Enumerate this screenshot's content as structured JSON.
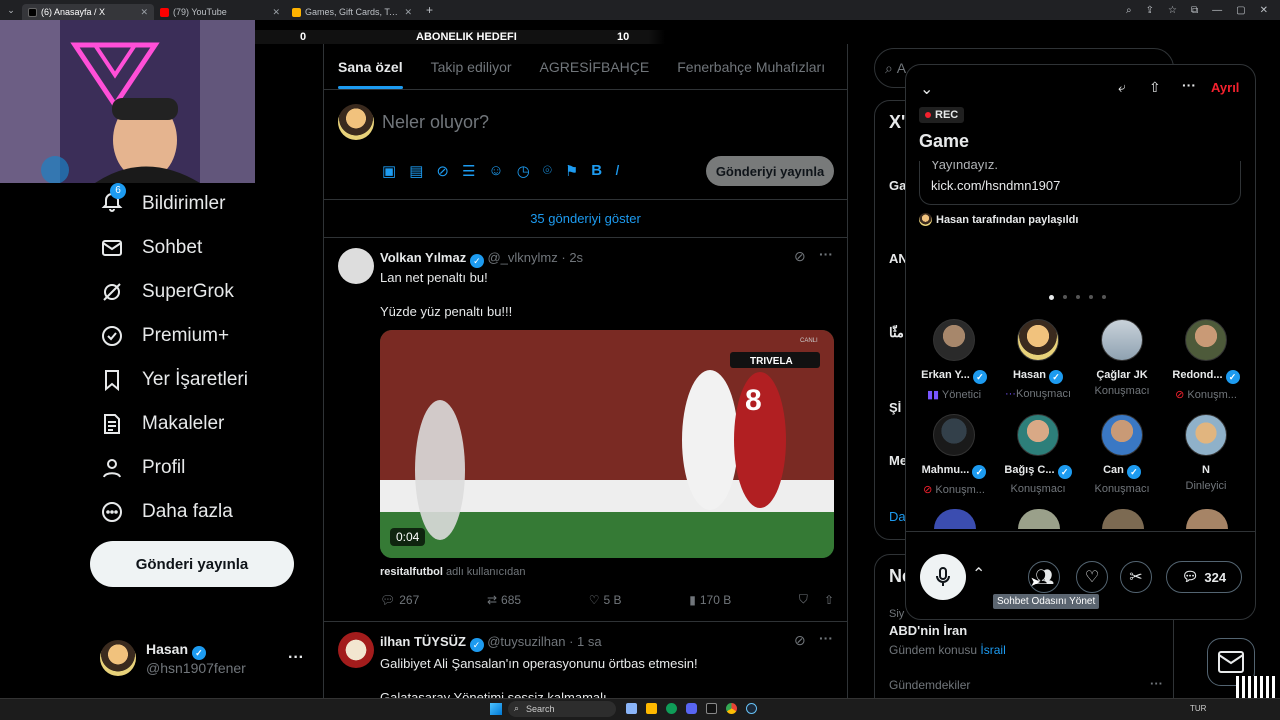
{
  "browser": {
    "tabs": [
      {
        "label": "(6) Anasayfa / X",
        "active": true,
        "color": "#ffffff"
      },
      {
        "label": "(79) YouTube",
        "active": false,
        "color": "#ff0000"
      },
      {
        "label": "Games, Gift Cards, Top-Ups & ...",
        "active": false,
        "color": "#ffb300"
      }
    ],
    "new_tab": "+"
  },
  "overlay": {
    "left_value": "0",
    "goal_label": "ABONELIK HEDEFI",
    "right_value": "10"
  },
  "nav": {
    "notif_badge": "6",
    "items": [
      {
        "label": "Bildirimler",
        "icon": "bell-icon"
      },
      {
        "label": "Sohbet",
        "icon": "mail-icon"
      },
      {
        "label": "SuperGrok",
        "icon": "grok-icon"
      },
      {
        "label": "Premium+",
        "icon": "premium-icon"
      },
      {
        "label": "Yer İşaretleri",
        "icon": "bookmark-icon"
      },
      {
        "label": "Makaleler",
        "icon": "article-icon"
      },
      {
        "label": "Profil",
        "icon": "person-icon"
      },
      {
        "label": "Daha fazla",
        "icon": "more-circle-icon"
      }
    ],
    "post_button": "Gönderi yayınla",
    "account": {
      "name": "Hasan",
      "handle": "@hsn1907fener",
      "more": "···"
    }
  },
  "timeline": {
    "tabs": [
      "Sana özel",
      "Takip ediliyor",
      "AGRESİFBAHÇE",
      "Fenerbahçe Muhafızları",
      "FE"
    ],
    "compose_placeholder": "Neler oluyor?",
    "compose_button": "Gönderiyi yayınla",
    "show_more": "35 gönderiyi göster",
    "tweets": [
      {
        "name": "Volkan Yılmaz",
        "handle": "@_vlknylmz",
        "time": "· 2s",
        "lines": [
          "Lan net penaltı bu!",
          "Yüzde yüz penaltı bu!!!"
        ],
        "video_time": "0:04",
        "media_scoreboard": "TRIVELA",
        "media_badge": "CANLI",
        "media_jersey": "8",
        "source_name": "resitalfutbol",
        "source_suffix": "adlı kullanıcıdan",
        "replies": "267",
        "retweets": "685",
        "likes": "5 B",
        "views": "170 B"
      },
      {
        "name": "ilhan TÜYSÜZ",
        "handle": "@tuysuzilhan",
        "time": "· 1 sa",
        "lines": [
          "Galibiyet Ali Şansalan'ın operasyonunu örtbas etmesin!",
          "Galatasaray Yönetimi sessiz kalmamalı"
        ]
      }
    ]
  },
  "right": {
    "search_placeholder": "A",
    "labels": [
      "X'",
      "Ga",
      "AN",
      "مثّا",
      "Şİ",
      "Me",
      "Da",
      "Ne"
    ],
    "trend_meta": "Siy",
    "trend_title": "ABD'nin İran",
    "trend_sub": "Gündem konusu",
    "trend_link": "İsrail",
    "trend_label": "Gündemdekiler",
    "trend_more": "···"
  },
  "space": {
    "rec": "REC",
    "title": "Game",
    "leave": "Ayrıl",
    "desc_top": "Yayındayız.",
    "desc_link": "kick.com/hsndmn1907",
    "shared_by": "Hasan tarafından paylaşıldı",
    "speakers": [
      {
        "name": "Erkan Y...",
        "role": "Yönetici",
        "verified": true
      },
      {
        "name": "Hasan",
        "role": "Konuşmacı",
        "verified": true
      },
      {
        "name": "Çağlar JK",
        "role": "Konuşmacı",
        "verified": false
      },
      {
        "name": "Redond...",
        "role": "Konuşm...",
        "verified": true
      },
      {
        "name": "Mahmu...",
        "role": "Konuşm...",
        "verified": true
      },
      {
        "name": "Bağış C...",
        "role": "Konuşmacı",
        "verified": true
      },
      {
        "name": "Can",
        "role": "Konuşmacı",
        "verified": true
      },
      {
        "name": "N",
        "role": "Dinleyici",
        "verified": false
      }
    ],
    "comment_count": "324",
    "tooltip": "Sohbet Odasını Yönet"
  },
  "taskbar": {
    "search": "Search",
    "lang": "TUR"
  }
}
